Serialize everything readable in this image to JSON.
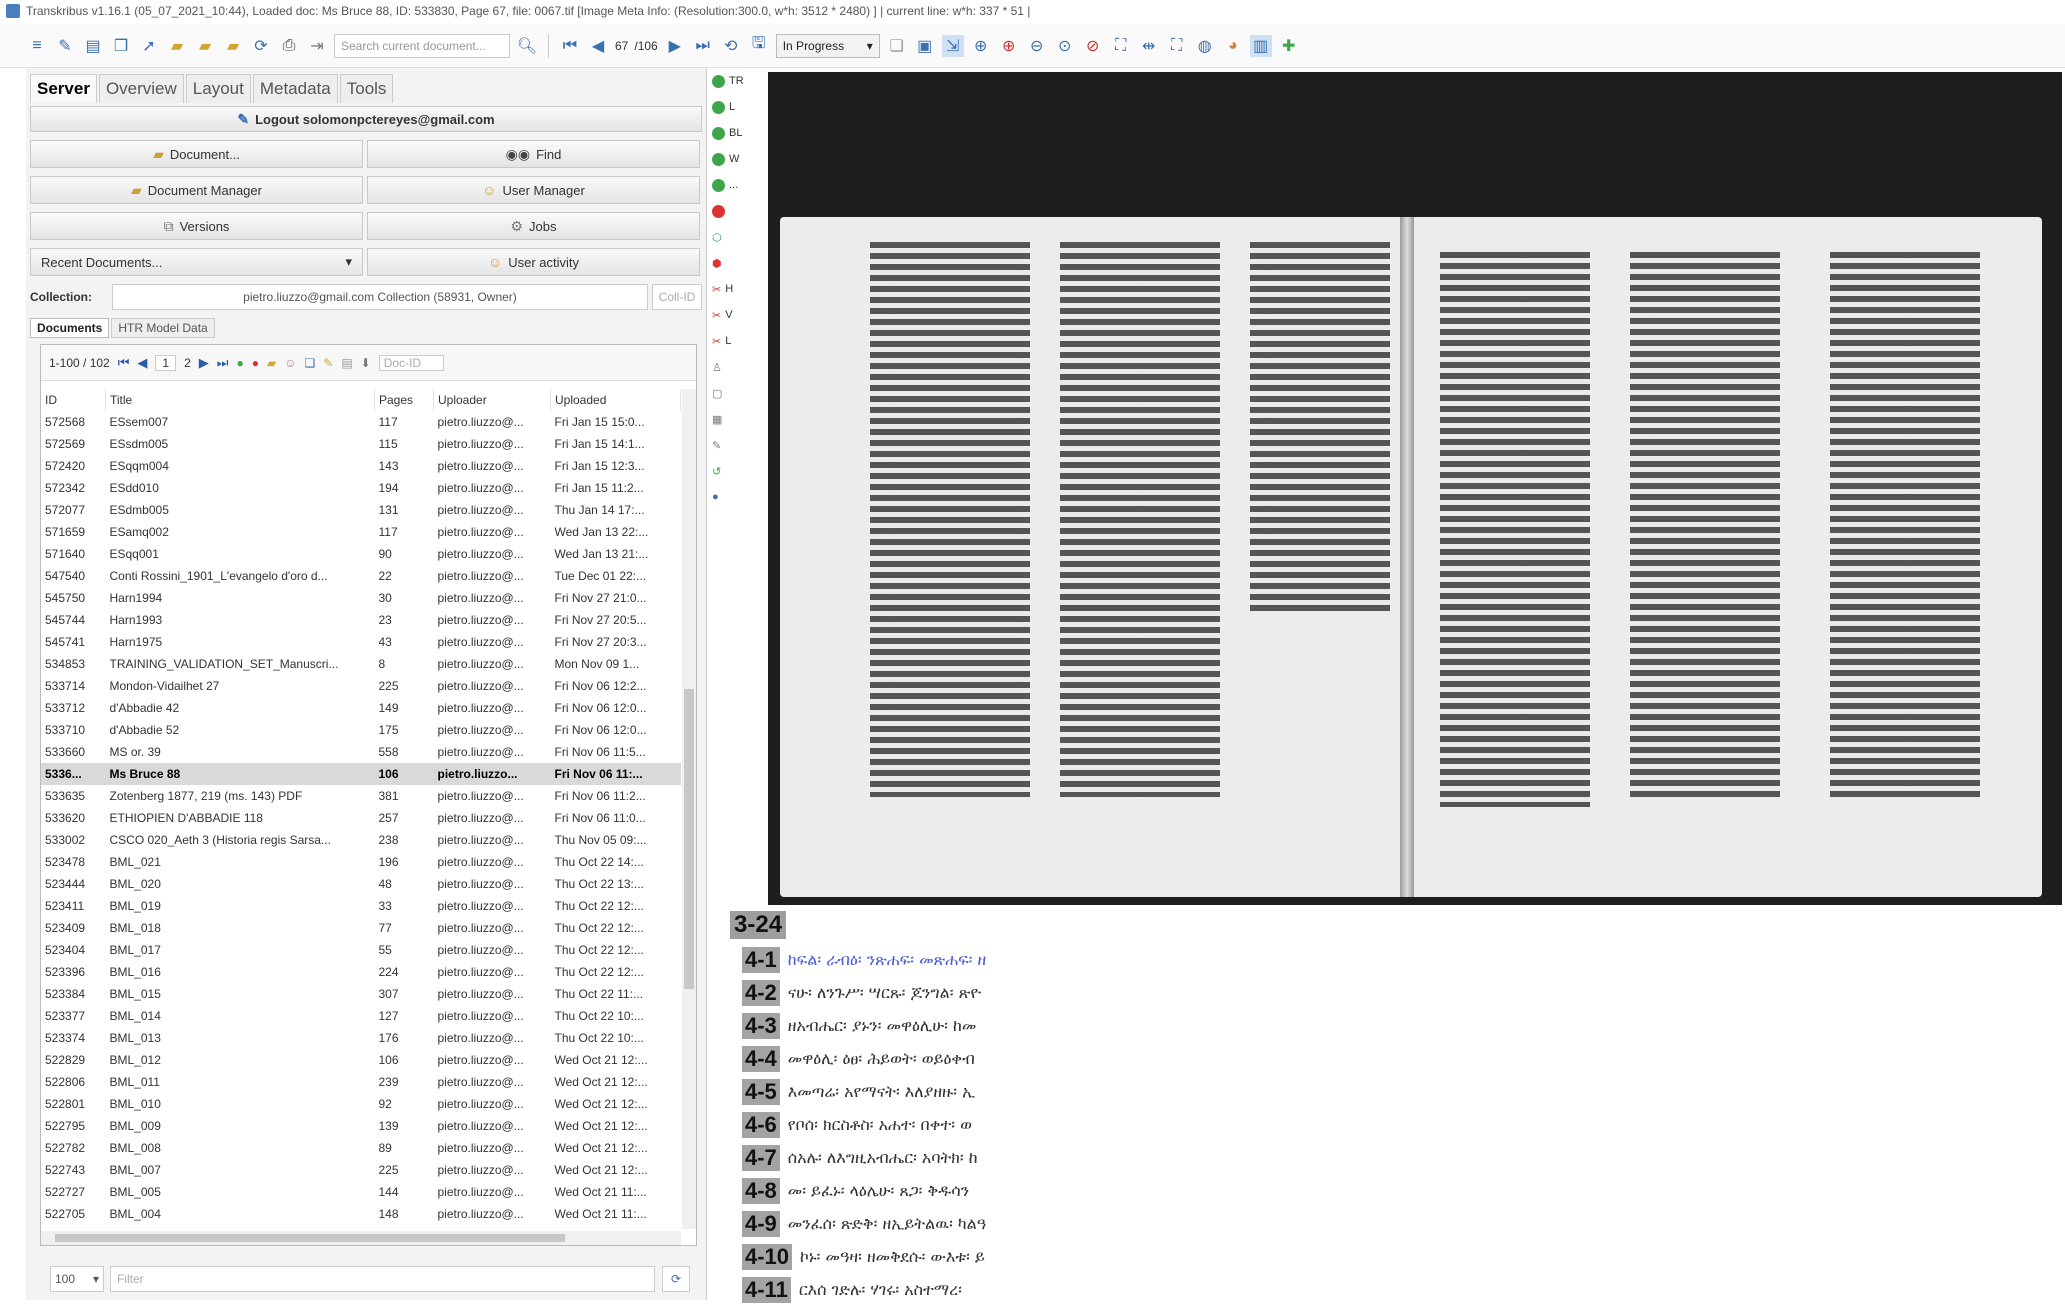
{
  "window": {
    "title": "Transkribus v1.16.1 (05_07_2021_10:44), Loaded doc: Ms Bruce 88, ID: 533830, Page 67, file: 0067.tif [Image Meta Info: (Resolution:300.0, w*h: 3512 * 2480) ] | current line: w*h: 337 * 51 |"
  },
  "toolbar": {
    "search_placeholder": "Search current document...",
    "page_current": "67",
    "page_total": "/106",
    "status_select": "In Progress"
  },
  "left_tabs": [
    "Server",
    "Overview",
    "Layout",
    "Metadata",
    "Tools"
  ],
  "server": {
    "logout": "Logout solomonpctereyes@gmail.com",
    "document_btn": "Document...",
    "find_btn": "Find",
    "doc_manager_btn": "Document Manager",
    "user_manager_btn": "User Manager",
    "versions_btn": "Versions",
    "jobs_btn": "Jobs",
    "recent_docs": "Recent Documents...",
    "user_activity_btn": "User activity",
    "collection_label": "Collection:",
    "collection_value": "pietro.liuzzo@gmail.com Collection (58931, Owner)",
    "collection_id": "Coll-ID"
  },
  "doc_tabs": [
    "Documents",
    "HTR Model Data"
  ],
  "pager": {
    "range": "1-100 / 102",
    "page1": "1",
    "page2": "2",
    "doc_id": "Doc-ID"
  },
  "table": {
    "headers": [
      "ID",
      "Title",
      "Pages",
      "Uploader",
      "Uploaded"
    ],
    "rows": [
      [
        "572568",
        "ESsem007",
        "117",
        "pietro.liuzzo@...",
        "Fri Jan 15 15:0..."
      ],
      [
        "572569",
        "ESsdm005",
        "115",
        "pietro.liuzzo@...",
        "Fri Jan 15 14:1..."
      ],
      [
        "572420",
        "ESqqm004",
        "143",
        "pietro.liuzzo@...",
        "Fri Jan 15 12:3..."
      ],
      [
        "572342",
        "ESdd010",
        "194",
        "pietro.liuzzo@...",
        "Fri Jan 15 11:2..."
      ],
      [
        "572077",
        "ESdmb005",
        "131",
        "pietro.liuzzo@...",
        "Thu Jan 14 17:..."
      ],
      [
        "571659",
        "ESamq002",
        "117",
        "pietro.liuzzo@...",
        "Wed Jan 13 22:..."
      ],
      [
        "571640",
        "ESqq001",
        "90",
        "pietro.liuzzo@...",
        "Wed Jan 13 21:..."
      ],
      [
        "547540",
        "Conti Rossini_1901_L'evangelo d'oro d...",
        "22",
        "pietro.liuzzo@...",
        "Tue Dec 01 22:..."
      ],
      [
        "545750",
        "Harn1994",
        "30",
        "pietro.liuzzo@...",
        "Fri Nov 27 21:0..."
      ],
      [
        "545744",
        "Harn1993",
        "23",
        "pietro.liuzzo@...",
        "Fri Nov 27 20:5..."
      ],
      [
        "545741",
        "Harn1975",
        "43",
        "pietro.liuzzo@...",
        "Fri Nov 27 20:3..."
      ],
      [
        "534853",
        "TRAINING_VALIDATION_SET_Manuscri...",
        "8",
        "pietro.liuzzo@...",
        "Mon Nov 09 1..."
      ],
      [
        "533714",
        "Mondon-Vidailhet 27",
        "225",
        "pietro.liuzzo@...",
        "Fri Nov 06 12:2..."
      ],
      [
        "533712",
        "d'Abbadie 42",
        "149",
        "pietro.liuzzo@...",
        "Fri Nov 06 12:0..."
      ],
      [
        "533710",
        "d'Abbadie 52",
        "175",
        "pietro.liuzzo@...",
        "Fri Nov 06 12:0..."
      ],
      [
        "533660",
        "MS or. 39",
        "558",
        "pietro.liuzzo@...",
        "Fri Nov 06 11:5..."
      ],
      [
        "5336...",
        "Ms Bruce 88",
        "106",
        "pietro.liuzzo...",
        "Fri Nov 06 11:..."
      ],
      [
        "533635",
        "Zotenberg 1877, 219 (ms. 143) PDF",
        "381",
        "pietro.liuzzo@...",
        "Fri Nov 06 11:2..."
      ],
      [
        "533620",
        "ETHIOPIEN D'ABBADIE 118",
        "257",
        "pietro.liuzzo@...",
        "Fri Nov 06 11:0..."
      ],
      [
        "533002",
        "CSCO 020_Aeth 3 (Historia regis Sarsa...",
        "238",
        "pietro.liuzzo@...",
        "Thu Nov 05 09:..."
      ],
      [
        "523478",
        "BML_021",
        "196",
        "pietro.liuzzo@...",
        "Thu Oct 22 14:..."
      ],
      [
        "523444",
        "BML_020",
        "48",
        "pietro.liuzzo@...",
        "Thu Oct 22 13:..."
      ],
      [
        "523411",
        "BML_019",
        "33",
        "pietro.liuzzo@...",
        "Thu Oct 22 12:..."
      ],
      [
        "523409",
        "BML_018",
        "77",
        "pietro.liuzzo@...",
        "Thu Oct 22 12:..."
      ],
      [
        "523404",
        "BML_017",
        "55",
        "pietro.liuzzo@...",
        "Thu Oct 22 12:..."
      ],
      [
        "523396",
        "BML_016",
        "224",
        "pietro.liuzzo@...",
        "Thu Oct 22 12:..."
      ],
      [
        "523384",
        "BML_015",
        "307",
        "pietro.liuzzo@...",
        "Thu Oct 22 11:..."
      ],
      [
        "523377",
        "BML_014",
        "127",
        "pietro.liuzzo@...",
        "Thu Oct 22 10:..."
      ],
      [
        "523374",
        "BML_013",
        "176",
        "pietro.liuzzo@...",
        "Thu Oct 22 10:..."
      ],
      [
        "522829",
        "BML_012",
        "106",
        "pietro.liuzzo@...",
        "Wed Oct 21 12:..."
      ],
      [
        "522806",
        "BML_011",
        "239",
        "pietro.liuzzo@...",
        "Wed Oct 21 12:..."
      ],
      [
        "522801",
        "BML_010",
        "92",
        "pietro.liuzzo@...",
        "Wed Oct 21 12:..."
      ],
      [
        "522795",
        "BML_009",
        "139",
        "pietro.liuzzo@...",
        "Wed Oct 21 12:..."
      ],
      [
        "522782",
        "BML_008",
        "89",
        "pietro.liuzzo@...",
        "Wed Oct 21 12:..."
      ],
      [
        "522743",
        "BML_007",
        "225",
        "pietro.liuzzo@...",
        "Wed Oct 21 12:..."
      ],
      [
        "522727",
        "BML_005",
        "144",
        "pietro.liuzzo@...",
        "Wed Oct 21 11:..."
      ],
      [
        "522705",
        "BML_004",
        "148",
        "pietro.liuzzo@...",
        "Wed Oct 21 11:..."
      ]
    ],
    "selected_index": 16
  },
  "filter": {
    "page_size": "100",
    "placeholder": "Filter"
  },
  "status_strip": [
    "TR",
    "L",
    "BL",
    "W",
    "...",
    "",
    "",
    "",
    "H",
    "V",
    "L"
  ],
  "transcript": {
    "region": "3-24",
    "lines": [
      {
        "num": "4-1",
        "text": "ከፍል፡ ራብዕ፡ ንጽሐፍ፡ መጽሐፍ፡ ዘ"
      },
      {
        "num": "4-2",
        "text": "ናሁ፡ ለንጉሥ፡ ሣርጹ፡ ጆንግል፡ ጽዮ"
      },
      {
        "num": "4-3",
        "text": "ዘአብሔር፡ ያኑን፡ መዋዕሊሁ፡ ከመ"
      },
      {
        "num": "4-4",
        "text": "መዋዕሊ፡ ዕፀ፡ ሕይወት፡ ወይዕቀብ"
      },
      {
        "num": "4-5",
        "text": "እመጣሬ፡ አየማናት፡ እለያዘዙ፡ ኢ"
      },
      {
        "num": "4-6",
        "text": "የቦሰ፡ ክርስቶስ፡ አሐተ፡ በቀተ፡ ወ"
      },
      {
        "num": "4-7",
        "text": "ሰአሉ፡ ለእግዚአብሔር፡ አባትክ፡ ከ"
      },
      {
        "num": "4-8",
        "text": "መ፡ ይፈኑ፡ ላዕሌሁ፡ ጸጋ፡ ቅዱሳን"
      },
      {
        "num": "4-9",
        "text": "መንፈሰ፡ ጽድቅ፡ ዘኢይትልዉ፡ ካልዓ"
      },
      {
        "num": "4-10",
        "text": "ኮኑ፡ መዓዛ፡ ዘመቅደሱ፡ ውእቱ፡ ይ"
      },
      {
        "num": "4-11",
        "text": "ርእሰ ገድሉ፡ ሃገሩ፡ አስተማረ፡"
      }
    ]
  }
}
